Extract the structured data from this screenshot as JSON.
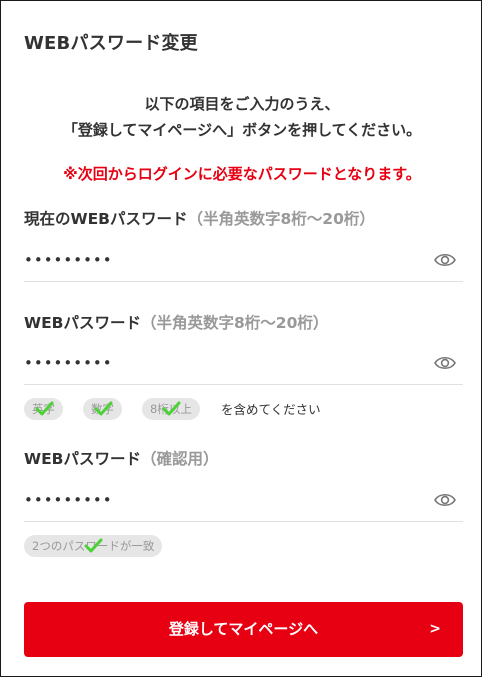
{
  "page": {
    "title": "WEBパスワード変更",
    "intro_line1": "以下の項目をご入力のうえ、",
    "intro_line2": "「登録してマイページへ」ボタンを押してください。",
    "warning": "※次回からログインに必要なパスワードとなります。"
  },
  "fields": {
    "current": {
      "label": "現在のWEBパスワード",
      "hint": "（半角英数字8桁〜20桁）",
      "value": "•••••••••",
      "icon": "eye-icon"
    },
    "new": {
      "label": "WEBパスワード",
      "hint": "（半角英数字8桁〜20桁）",
      "value": "•••••••••",
      "icon": "eye-icon"
    },
    "confirm": {
      "label": "WEBパスワード",
      "hint": "（確認用）",
      "value": "•••••••••",
      "icon": "eye-icon"
    }
  },
  "rules": {
    "chips": [
      "英字",
      "数字",
      "8桁以上"
    ],
    "note": "を含めてください",
    "match_chip": "2つのパスワードが一致"
  },
  "submit": {
    "label": "登録してマイページへ",
    "arrow": ">"
  },
  "colors": {
    "accent": "#e60012",
    "chip_bg": "#e6e6e6",
    "chip_text": "#999999",
    "check": "#4cd137",
    "text": "#333333"
  }
}
